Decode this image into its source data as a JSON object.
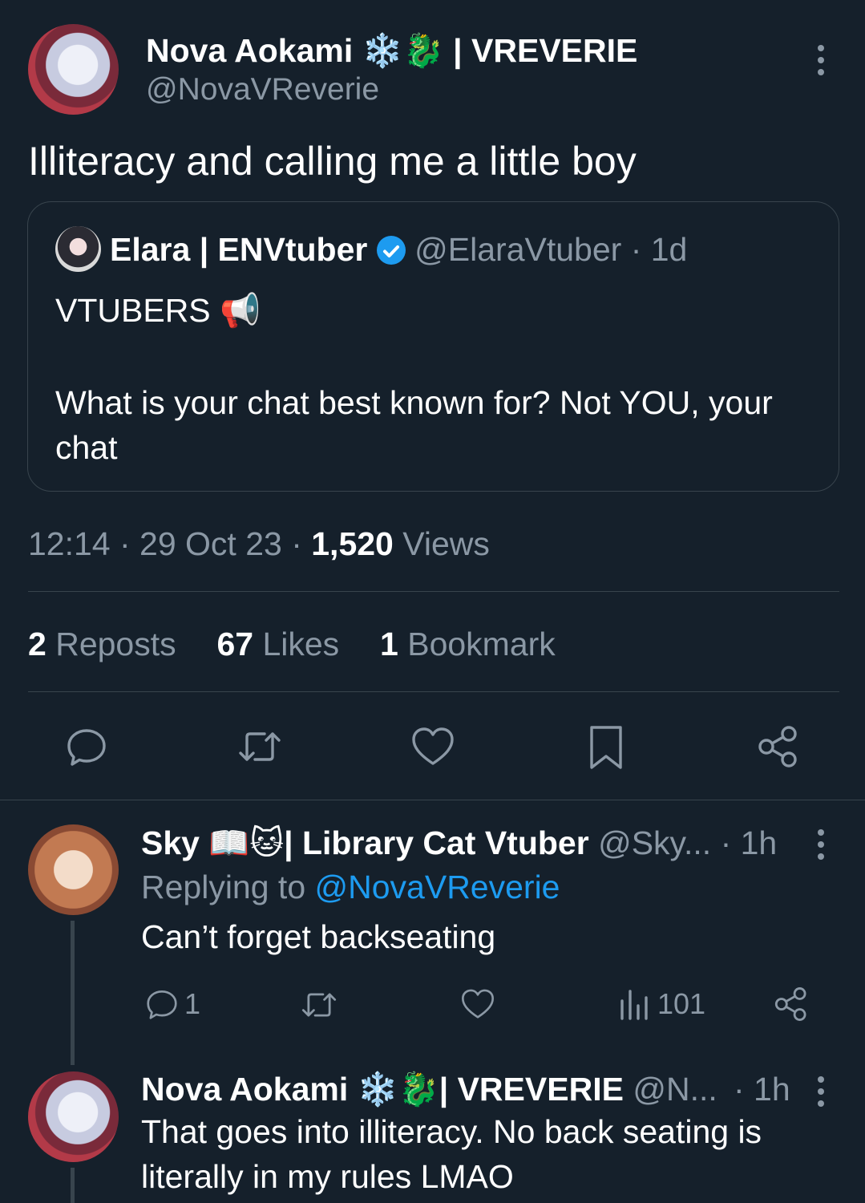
{
  "main_tweet": {
    "author_name": "Nova Aokami",
    "author_emoji": "❄️🐉",
    "author_suffix": "| VREVERIE",
    "author_handle": "@NovaVReverie",
    "text": "Illiteracy and calling me a little boy",
    "timestamp": "12:14 · 29 Oct 23 · ",
    "views_count": "1,520",
    "views_label": " Views"
  },
  "quoted_tweet": {
    "author_name": "Elara | ENVtuber",
    "author_handle": "@ElaraVtuber · 1d",
    "line1": "VTUBERS 📢",
    "line2": "What is your chat best known for? Not YOU, your chat"
  },
  "stats": {
    "reposts_count": "2",
    "reposts_label": "Reposts",
    "likes_count": "67",
    "likes_label": "Likes",
    "bookmarks_count": "1",
    "bookmarks_label": "Bookmark"
  },
  "actions": {
    "reply_icon": "reply-icon",
    "repost_icon": "repost-icon",
    "like_icon": "heart-icon",
    "bookmark_icon": "bookmark-icon",
    "share_icon": "share-icon"
  },
  "replies": [
    {
      "author_name": "Sky 📖🐱| Library Cat Vtuber",
      "author_handle": "@Sky... · 1h",
      "replying_prefix": "Replying to ",
      "replying_to": "@NovaVReverie",
      "text": "Can’t forget backseating",
      "reply_count": "1",
      "views_count": "101"
    },
    {
      "author_name": "Nova Aokami ❄️🐉| VREVERIE",
      "author_handle": "@N...",
      "time": "· 1h",
      "text_line1": "That goes into illiteracy. No back seating is",
      "text_line2": "literally in my rules LMAO"
    }
  ],
  "colors": {
    "background": "#15202b",
    "muted": "#8b98a5",
    "link": "#1d9bf0",
    "border": "#38444d"
  }
}
